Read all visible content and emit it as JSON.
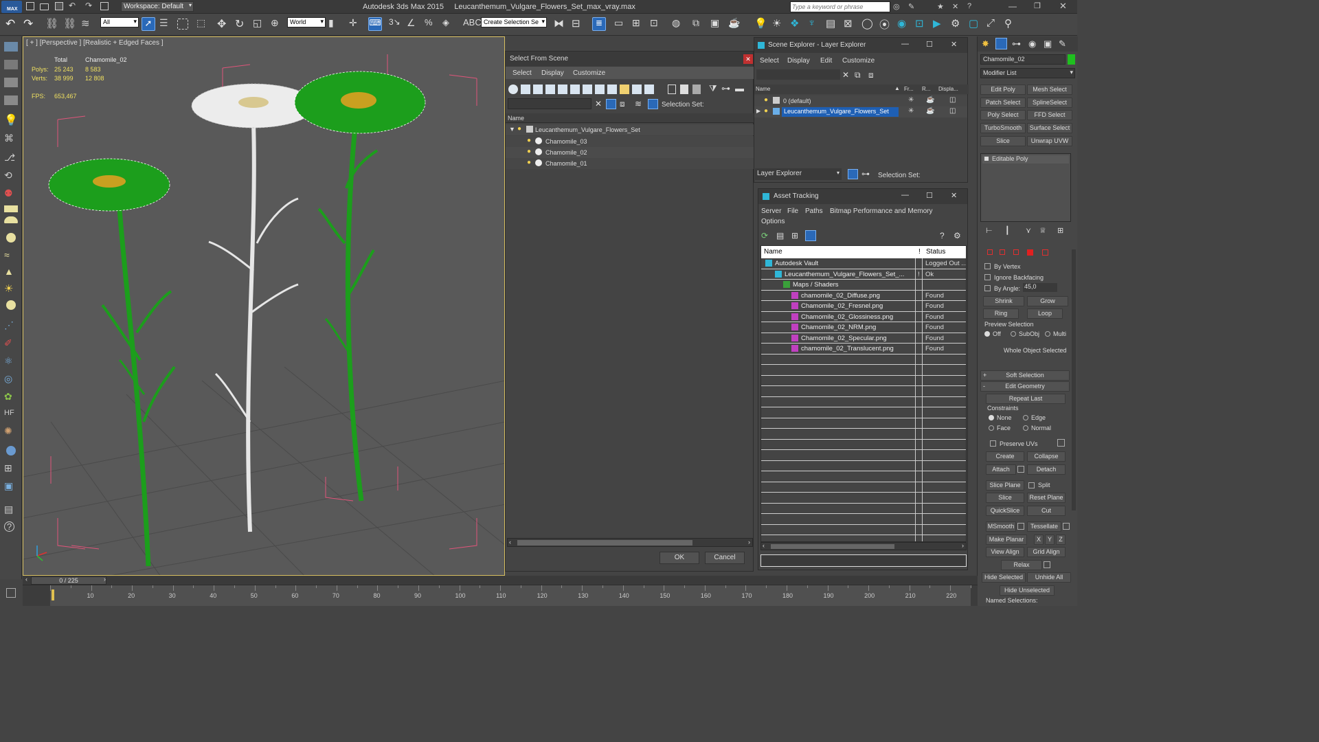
{
  "title": {
    "app": "Autodesk 3ds Max  2015",
    "file": "Leucanthemum_Vulgare_Flowers_Set_max_vray.max",
    "workspace": "Workspace: Default",
    "search_placeholder": "Type a keyword or phrase"
  },
  "toolbar": {
    "filter": "All",
    "coord": "World",
    "selection_set": "Create Selection Se"
  },
  "viewport": {
    "label": "[ + ] [Perspective ] [Realistic + Edged Faces ]",
    "stats_header_total": "Total",
    "stats_header_object": "Chamomile_02",
    "polys_label": "Polys:",
    "polys_total": "25 243",
    "polys_object": "8 583",
    "verts_label": "Verts:",
    "verts_total": "38 999",
    "verts_object": "12 808",
    "fps_label": "FPS:",
    "fps_value": "653,467"
  },
  "select_from_scene": {
    "title": "Select From Scene",
    "menu": [
      "Select",
      "Display",
      "Customize"
    ],
    "selection_set_label": "Selection Set:",
    "column_name": "Name",
    "root": "Leucanthemum_Vulgare_Flowers_Set",
    "items": [
      "Chamomile_03",
      "Chamomile_02",
      "Chamomile_01"
    ],
    "ok": "OK",
    "cancel": "Cancel"
  },
  "scene_explorer": {
    "title": "Scene Explorer - Layer Explorer",
    "menu": [
      "Select",
      "Display",
      "Edit",
      "Customize"
    ],
    "col_name": "Name",
    "col_fr": "Fr...",
    "col_r": "R...",
    "col_disp": "Displa...",
    "layers": [
      "0 (default)",
      "Leucanthemum_Vulgare_Flowers_Set"
    ],
    "footer_label": "Layer Explorer",
    "selection_set_label": "Selection Set:"
  },
  "asset_tracking": {
    "title": "Asset Tracking",
    "menu": [
      "Server",
      "File",
      "Paths",
      "Bitmap Performance and Memory",
      "Options"
    ],
    "col_name": "Name",
    "col_flag": "!",
    "col_status": "Status",
    "rows": [
      {
        "name": "Autodesk Vault",
        "status": "Logged Out ..."
      },
      {
        "name": "Leucanthemum_Vulgare_Flowers_Set_...",
        "flag": "!",
        "status": "Ok"
      },
      {
        "name": "Maps / Shaders",
        "status": ""
      },
      {
        "name": "chamomile_02_Diffuse.png",
        "status": "Found"
      },
      {
        "name": "Chamomile_02_Fresnel.png",
        "status": "Found"
      },
      {
        "name": "Chamomile_02_Glossiness.png",
        "status": "Found"
      },
      {
        "name": "Chamomile_02_NRM.png",
        "status": "Found"
      },
      {
        "name": "Chamomile_02_Specular.png",
        "status": "Found"
      },
      {
        "name": "chamomile_02_Translucent.png",
        "status": "Found"
      }
    ]
  },
  "command_panel": {
    "object_name": "Chamomile_02",
    "modifier_list": "Modifier List",
    "modifiers": [
      "Edit Poly",
      "Mesh Select",
      "Patch Select",
      "SplineSelect",
      "Poly Select",
      "FFD Select",
      "TurboSmooth",
      "Surface Select",
      "Slice",
      "Unwrap UVW"
    ],
    "stack_item": "Editable Poly",
    "by_vertex": "By Vertex",
    "ignore_backfacing": "Ignore Backfacing",
    "by_angle": "By Angle:",
    "by_angle_value": "45,0",
    "shrink": "Shrink",
    "grow": "Grow",
    "ring": "Ring",
    "loop": "Loop",
    "preview_selection": "Preview Selection",
    "preview_off": "Off",
    "preview_subobj": "SubObj",
    "preview_multi": "Multi",
    "whole_object": "Whole Object Selected",
    "soft_selection": "Soft Selection",
    "edit_geometry": "Edit Geometry",
    "repeat_last": "Repeat Last",
    "constraints": "Constraints",
    "c_none": "None",
    "c_edge": "Edge",
    "c_face": "Face",
    "c_normal": "Normal",
    "preserve_uvs": "Preserve UVs",
    "create": "Create",
    "collapse": "Collapse",
    "attach": "Attach",
    "detach": "Detach",
    "slice_plane": "Slice Plane",
    "split": "Split",
    "slice": "Slice",
    "reset_plane": "Reset Plane",
    "quickslice": "QuickSlice",
    "cut": "Cut",
    "msmooth": "MSmooth",
    "tessellate": "Tessellate",
    "make_planar": "Make Planar",
    "x": "X",
    "y": "Y",
    "z": "Z",
    "view_align": "View Align",
    "grid_align": "Grid Align",
    "relax": "Relax",
    "hide_selected": "Hide Selected",
    "unhide_all": "Unhide All",
    "hide_unselected": "Hide Unselected",
    "named_selections": "Named Selections:"
  },
  "timeline": {
    "frame": "0 / 225",
    "ticks": [
      "10",
      "20",
      "30",
      "40",
      "50",
      "60",
      "70",
      "80",
      "90",
      "100",
      "110",
      "120",
      "130",
      "140",
      "150",
      "160",
      "170",
      "180",
      "190",
      "200",
      "210",
      "220"
    ]
  },
  "colors": {
    "accent": "#1e5fb4",
    "flower_green": "#1c9e1c",
    "bbox": "#e0557a"
  }
}
